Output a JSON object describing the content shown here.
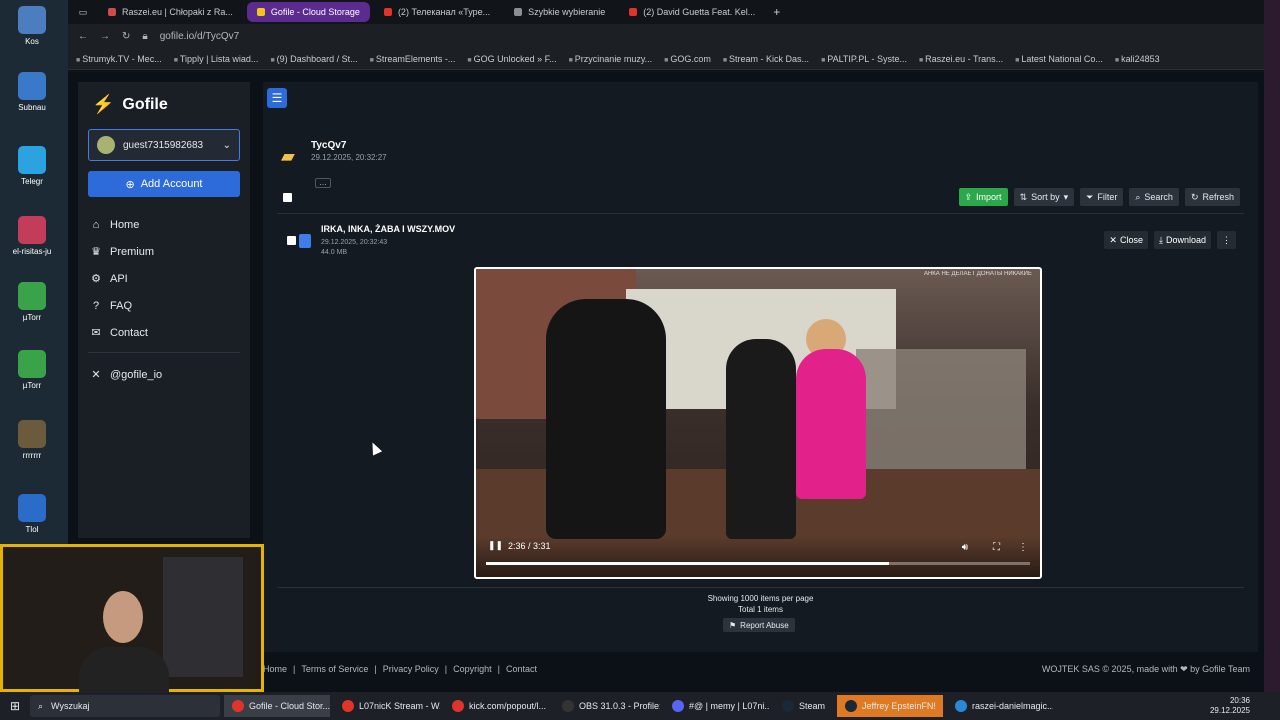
{
  "desktop": {
    "icons": [
      {
        "label": "Kos",
        "color": "#4b7dbf"
      },
      {
        "label": "Subnau",
        "color": "#3a78c9"
      },
      {
        "label": "Telegr",
        "color": "#2aa3e0"
      },
      {
        "label": "el-risitas-ju",
        "color": "#c33c5a"
      },
      {
        "label": "µTorr",
        "color": "#3aa34a"
      },
      {
        "label": "µTorr",
        "color": "#3aa34a"
      },
      {
        "label": "rrrrrrr",
        "color": "#6b5a3c"
      },
      {
        "label": "Tlol",
        "color": "#2b6cc9"
      }
    ]
  },
  "browser": {
    "tabs": [
      {
        "label": "Raszei.eu | Chłopaki z Ra...",
        "active": false,
        "color": "#d14b4b"
      },
      {
        "label": "Gofile - Cloud Storage",
        "active": true,
        "color": "#f5c518"
      },
      {
        "label": "(2) Телеканал «Туре...",
        "active": false,
        "color": "#e0342b"
      },
      {
        "label": "Szybkie wybieranie",
        "active": false,
        "color": "#8a8f96"
      },
      {
        "label": "(2) David Guetta Feat. Kel...",
        "active": false,
        "color": "#e0342b"
      }
    ],
    "url": "gofile.io/d/TycQv7",
    "bookmarks": [
      "Strumyk.TV - Mec...",
      "Tipply | Lista wiad...",
      "(9) Dashboard / St...",
      "StreamElements -...",
      "GOG Unlocked » F...",
      "Przycinanie muzy...",
      "GOG.com",
      "Stream - Kick Das...",
      "PALTIP.PL - Syste...",
      "Raszei.eu - Trans...",
      "Latest National Co...",
      "kali24853"
    ]
  },
  "sidebar": {
    "logo": "Gofile",
    "account": "guest7315982683",
    "add_account": "Add Account",
    "nav": [
      {
        "label": "Home",
        "icon": "⌂"
      },
      {
        "label": "Premium",
        "icon": "♛"
      },
      {
        "label": "API",
        "icon": "⚙"
      },
      {
        "label": "FAQ",
        "icon": "?"
      },
      {
        "label": "Contact",
        "icon": "✉"
      }
    ],
    "social": "@gofile_io"
  },
  "folder": {
    "name": "TycQv7",
    "date": "29.12.2025, 20:32:27",
    "count": "1"
  },
  "toolbar": {
    "import": "Import",
    "sort": "Sort by",
    "filter": "Filter",
    "search": "Search",
    "refresh": "Refresh"
  },
  "file": {
    "name": "IRKA, INKA, ŻABA I WSZY.MOV",
    "date": "29.12.2025, 20:32:43",
    "size": "44.0 MB",
    "close": "Close",
    "download": "Download"
  },
  "video": {
    "time": "2:36 / 3:31",
    "progress": 0.74,
    "watermark": "АНКА НЕ ДЕЛАЕТ ДОНАТЫ НИКАКИЕ"
  },
  "listing": {
    "showing": "Showing 1000 items per page",
    "total": "Total 1 items",
    "report": "Report Abuse"
  },
  "footer": {
    "links": [
      "Home",
      "Terms of Service",
      "Privacy Policy",
      "Copyright",
      "Contact"
    ],
    "credit": "WOJTEK SAS © 2025, made with ❤ by Gofile Team"
  },
  "taskbar": {
    "search": "Wyszukaj",
    "apps": [
      {
        "label": "Gofile - Cloud Stor...",
        "color": "#e0342b",
        "state": "act"
      },
      {
        "label": "L07nicK Stream - W...",
        "color": "#e0342b",
        "state": ""
      },
      {
        "label": "kick.com/popout/l...",
        "color": "#e0342b",
        "state": ""
      },
      {
        "label": "OBS 31.0.3 - Profile:...",
        "color": "#333333",
        "state": ""
      },
      {
        "label": "#@ | memy | L07ni...",
        "color": "#5865f2",
        "state": ""
      },
      {
        "label": "Steam",
        "color": "#1b2838",
        "state": ""
      },
      {
        "label": "Jeffrey EpsteinFN!",
        "color": "#1b2838",
        "state": "hl"
      },
      {
        "label": "raszei-danielmagic...",
        "color": "#2b88d8",
        "state": ""
      }
    ],
    "time": "20:36",
    "date": "29.12.2025"
  }
}
